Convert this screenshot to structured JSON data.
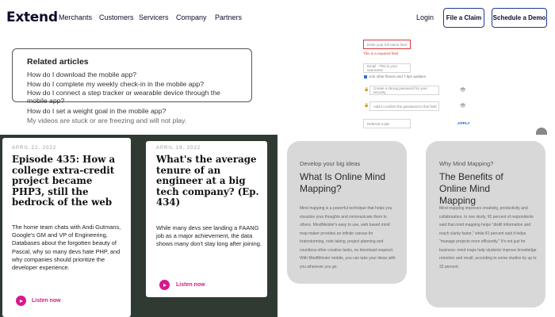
{
  "nav": {
    "logo": "Extend",
    "links": [
      "Merchants",
      "Customers",
      "Servicers",
      "Company",
      "Partners"
    ],
    "login": "Login",
    "file_claim": "File a Claim",
    "schedule_demo": "Schedule a Demo"
  },
  "related": {
    "title": "Related articles",
    "items": [
      "How do I download the mobile app?",
      "How do I complete my weekly check-in in the mobile app?",
      "How do I connect a step tracker or wearable device through the mobile app?",
      "How do I set a weight goal in the mobile app?",
      "My videos are stuck or are freezing and will not play."
    ]
  },
  "form": {
    "name_placeholder": "Enter your full name here",
    "name_error": "This is a required field",
    "email_placeholder": "Email - This is your username",
    "opt_in": "Join other fitness and ? tips updates",
    "password_placeholder": "Create a strong password for your security",
    "confirm_placeholder": "Add in confirm the password to this field",
    "promo_placeholder": "Referral Code",
    "apply": "APPLY"
  },
  "podcasts": [
    {
      "date": "APRIL 22, 2022",
      "title": "Episode 435: How a college extra-credit project became PHP3, still the bedrock of the web",
      "body": "The home team chats with Andi Gutmans, Google's GM and VP of Engineering, Databases about the forgotten beauty of Pascal, why so many devs hate PHP, and why companies should prioritize the developer experience.",
      "cta": "Listen now"
    },
    {
      "date": "APRIL 19, 2022",
      "title": "What's the average tenure of an engineer at a big tech company? (Ep. 434)",
      "body": "While many devs see landing a FAANG job as a major achievement, the data shows many don't stay long after joining.",
      "cta": "Listen now"
    }
  ],
  "mindmap": [
    {
      "kicker": "Develop your big ideas",
      "title": "What Is Online Mind Mapping?",
      "body": "Mind mapping is a powerful technique that helps you visualize your thoughts and communicate them to others. MindMeister's easy to use, web based mind map maker provides an infinite canvas for brainstorming, note taking, project planning and countless other creative tasks, no download required. With MindMeister mobile, you can take your ideas with you wherever you go."
    },
    {
      "kicker": "Why Mind Mapping?",
      "title": "The Benefits of Online Mind Mapping",
      "body": "Mind mapping improves creativity, productivity and collaboration. In one study, 92 percent of respondents said that mind mapping helps \"distill information and reach clarity faster,\" while 81 percent said it helps \"manage projects more efficiently.\" It's not just for business: mind maps help students improve knowledge retention and recall, according to some studies by up to 32 percent."
    }
  ]
}
